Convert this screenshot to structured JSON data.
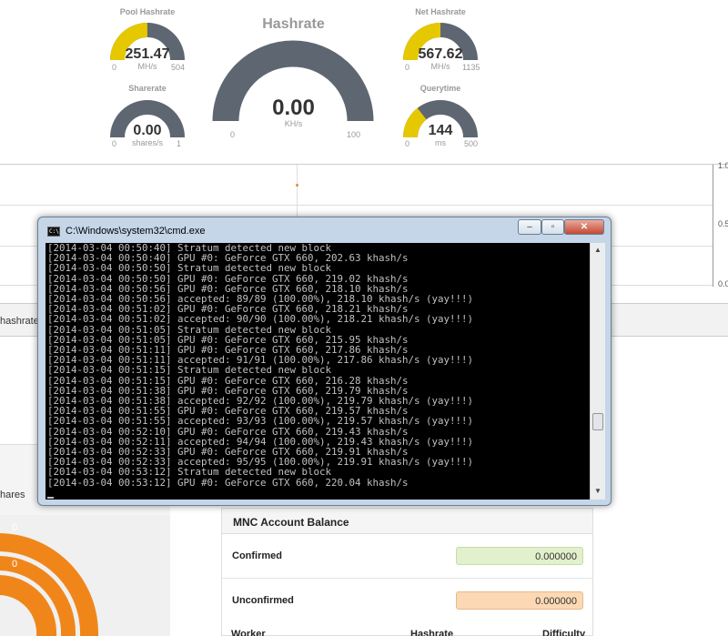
{
  "gauges": {
    "pool_hashrate": {
      "title": "Pool Hashrate",
      "value": "251.47",
      "unit": "MH/s",
      "min": "0",
      "max": "504",
      "level": 0.499,
      "color": "#e6c800"
    },
    "net_hashrate": {
      "title": "Net Hashrate",
      "value": "567.62",
      "unit": "MH/s",
      "min": "0",
      "max": "1135",
      "level": 0.5,
      "color": "#e6c800"
    },
    "sharerate": {
      "title": "Sharerate",
      "value": "0.00",
      "unit": "shares/s",
      "min": "0",
      "max": "1",
      "level": 0,
      "color": "#e6c800"
    },
    "querytime": {
      "title": "Querytime",
      "value": "144",
      "unit": "ms",
      "min": "0",
      "max": "500",
      "level": 0.288,
      "color": "#e6c800"
    },
    "hashrate": {
      "title": "Hashrate",
      "value": "0.00",
      "unit": "KH/s",
      "min": "0",
      "max": "100",
      "level": 0,
      "color": "#e6c800"
    }
  },
  "chart": {
    "yticks": [
      "1.0",
      "0.5",
      "0.0"
    ]
  },
  "tabs": {
    "hashrate": "hashrate b"
  },
  "shares_tab": "hares",
  "donut": {
    "labels": [
      "0",
      "0"
    ],
    "color": "#f0861a"
  },
  "cmd": {
    "title": "C:\\Windows\\system32\\cmd.exe",
    "icon_text": "C:\\",
    "buttons": {
      "minimize": "–",
      "maximize": "▫",
      "close": "✕"
    },
    "lines": [
      "[2014-03-04 00:50:40] Stratum detected new block",
      "[2014-03-04 00:50:40] GPU #0: GeForce GTX 660, 202.63 khash/s",
      "[2014-03-04 00:50:50] Stratum detected new block",
      "[2014-03-04 00:50:50] GPU #0: GeForce GTX 660, 219.02 khash/s",
      "[2014-03-04 00:50:56] GPU #0: GeForce GTX 660, 218.10 khash/s",
      "[2014-03-04 00:50:56] accepted: 89/89 (100.00%), 218.10 khash/s (yay!!!)",
      "[2014-03-04 00:51:02] GPU #0: GeForce GTX 660, 218.21 khash/s",
      "[2014-03-04 00:51:02] accepted: 90/90 (100.00%), 218.21 khash/s (yay!!!)",
      "[2014-03-04 00:51:05] Stratum detected new block",
      "[2014-03-04 00:51:05] GPU #0: GeForce GTX 660, 215.95 khash/s",
      "[2014-03-04 00:51:11] GPU #0: GeForce GTX 660, 217.86 khash/s",
      "[2014-03-04 00:51:11] accepted: 91/91 (100.00%), 217.86 khash/s (yay!!!)",
      "[2014-03-04 00:51:15] Stratum detected new block",
      "[2014-03-04 00:51:15] GPU #0: GeForce GTX 660, 216.28 khash/s",
      "[2014-03-04 00:51:38] GPU #0: GeForce GTX 660, 219.79 khash/s",
      "[2014-03-04 00:51:38] accepted: 92/92 (100.00%), 219.79 khash/s (yay!!!)",
      "[2014-03-04 00:51:55] GPU #0: GeForce GTX 660, 219.57 khash/s",
      "[2014-03-04 00:51:55] accepted: 93/93 (100.00%), 219.57 khash/s (yay!!!)",
      "[2014-03-04 00:52:10] GPU #0: GeForce GTX 660, 219.43 khash/s",
      "[2014-03-04 00:52:11] accepted: 94/94 (100.00%), 219.43 khash/s (yay!!!)",
      "[2014-03-04 00:52:33] GPU #0: GeForce GTX 660, 219.91 khash/s",
      "[2014-03-04 00:52:33] accepted: 95/95 (100.00%), 219.91 khash/s (yay!!!)",
      "[2014-03-04 00:53:12] Stratum detected new block",
      "[2014-03-04 00:53:12] GPU #0: GeForce GTX 660, 220.04 khash/s"
    ]
  },
  "balance": {
    "title": "MNC Account Balance",
    "confirmed_label": "Confirmed",
    "confirmed_value": "0.000000",
    "confirmed_color": "#e2f0cb",
    "unconfirmed_label": "Unconfirmed",
    "unconfirmed_value": "0.000000",
    "unconfirmed_color": "#fcd9b4",
    "columns": [
      "Worker",
      "Hashrate",
      "Difficulty"
    ]
  }
}
